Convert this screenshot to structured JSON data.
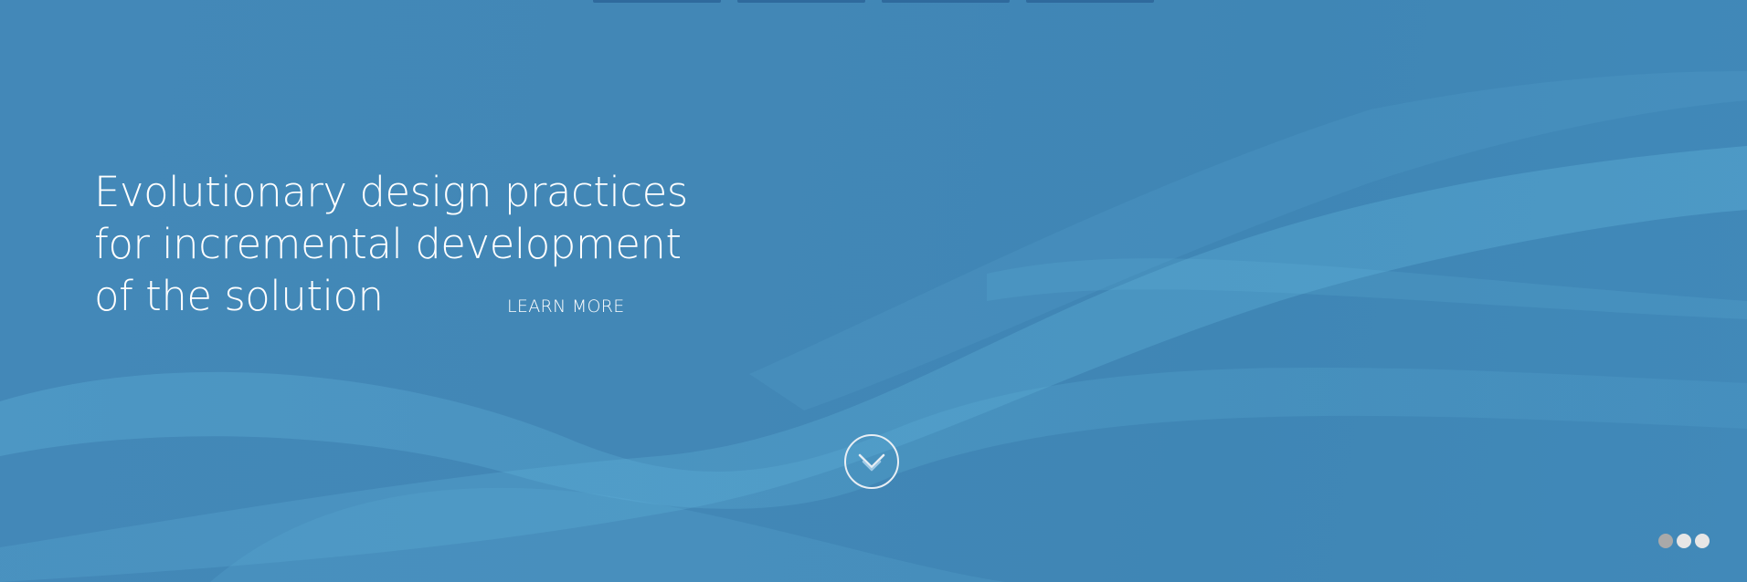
{
  "hero": {
    "headline": {
      "line1": "Evolutionary design practices",
      "line2": "for incremental development",
      "line3": "of the solution"
    },
    "learn_more_label": "LEARN MORE",
    "scroll_icon": "double-chevron-down-icon",
    "background_color": "#4287b6",
    "text_color": "#ffffff"
  },
  "nav": {
    "tab_count": 4,
    "tab_color": "#2f6a9d"
  },
  "carousel": {
    "slide_count": 3,
    "active_index": 0,
    "dot_color": "#e6e6e6",
    "active_dot_color": "#a9a9a9"
  }
}
